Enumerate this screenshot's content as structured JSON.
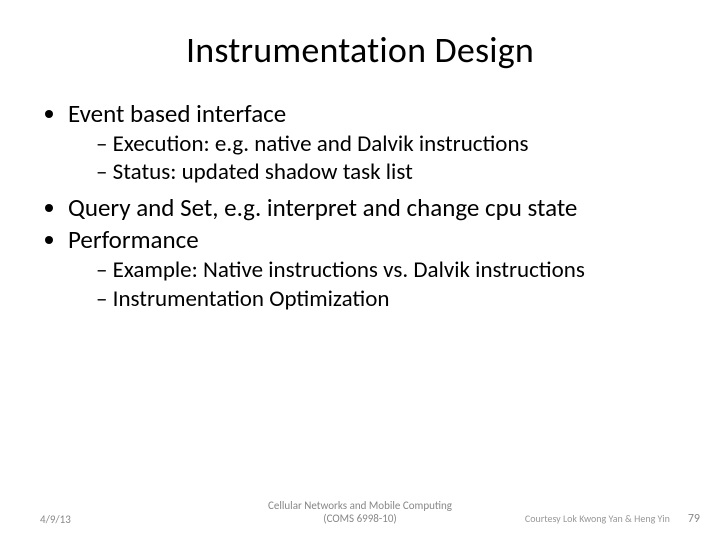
{
  "title": "Instrumentation Design",
  "bullets": {
    "b1": "Event based interface",
    "b1_sub1": "Execution: e.g. native and Dalvik instructions",
    "b1_sub2": "Status: updated shadow task list",
    "b2": "Query and Set, e.g. interpret and change cpu state",
    "b3": "Performance",
    "b3_sub1": "Example: Native instructions vs. Dalvik instructions",
    "b3_sub2": "Instrumentation Optimization"
  },
  "footer": {
    "date": "4/9/13",
    "center_line1": "Cellular Networks and Mobile Computing",
    "center_line2": "(COMS 6998-10)",
    "credit": "Courtesy Lok Kwong Yan & Heng Yin",
    "page": "79"
  }
}
